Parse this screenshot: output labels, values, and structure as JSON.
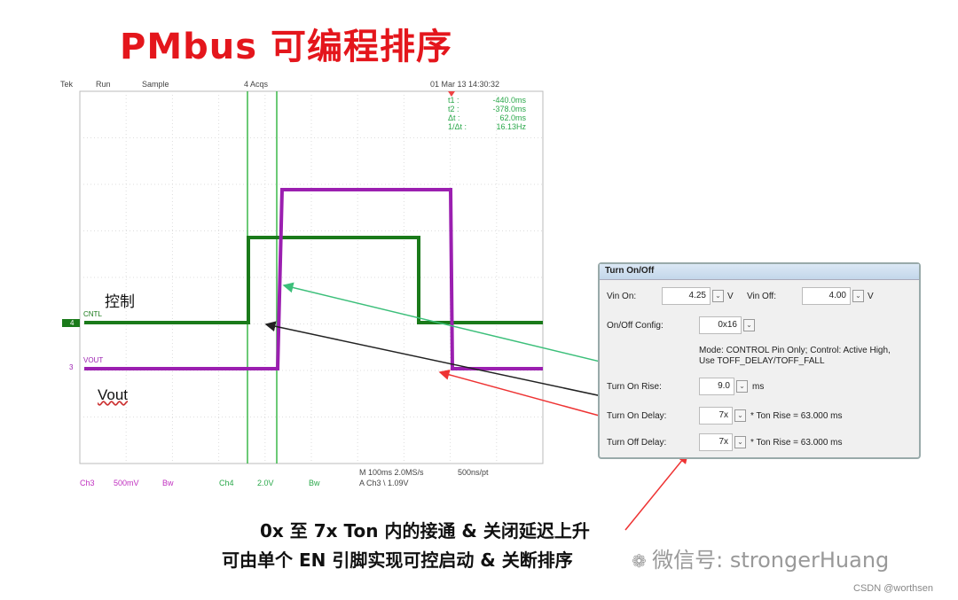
{
  "title": "PMbus 可编程排序",
  "scope": {
    "header": {
      "brand": "Tek",
      "state": "Run",
      "mode": "Sample",
      "acqs": "4 Acqs",
      "datetime": "01 Mar 13 14:30:32"
    },
    "cursors": [
      {
        "k": "t1 :",
        "v": "-440.0ms"
      },
      {
        "k": "t2 :",
        "v": "-378.0ms"
      },
      {
        "k": "Δt :",
        "v": "62.0ms"
      },
      {
        "k": "1/Δt :",
        "v": "16.13Hz"
      }
    ],
    "footer": {
      "ch3": "Ch3",
      "ch3_scale": "500mV",
      "ch3_bw": "Bw",
      "ch4": "Ch4",
      "ch4_scale": "2.0V",
      "ch4_bw": "Bw",
      "timebase": "M 100ms 2.0MS/s",
      "trigger": "A  Ch3  \\  1.09V",
      "pts": "500ns/pt"
    },
    "ch4_label": "CNTL",
    "ch4_marker": "4",
    "ch3_label": "VOUT",
    "ch3_marker": "3",
    "colors": {
      "ch4": "#1a7a1a",
      "ch3": "#9b1fb0",
      "cursor": "#3cb84a"
    }
  },
  "annotations": {
    "control": "控制",
    "vout": "Vout"
  },
  "panel": {
    "title": "Turn On/Off",
    "vin_on_label": "Vin On:",
    "vin_on": "4.25",
    "vin_on_unit": "V",
    "vin_off_label": "Vin Off:",
    "vin_off": "4.00",
    "vin_off_unit": "V",
    "config_label": "On/Off Config:",
    "config": "0x16",
    "mode_text1": "Mode: CONTROL Pin Only; Control: Active High,",
    "mode_text2": "Use TOFF_DELAY/TOFF_FALL",
    "rise_label": "Turn On Rise:",
    "rise": "9.0",
    "rise_unit": "ms",
    "on_delay_label": "Turn On Delay:",
    "on_delay": "7x",
    "on_delay_calc": "* Ton Rise =  63.000 ms",
    "off_delay_label": "Turn Off Delay:",
    "off_delay": "7x",
    "off_delay_calc": "* Ton Rise =  63.000 ms"
  },
  "caption": {
    "line1": "0x 至 7x Ton 内的接通 & 关闭延迟上升",
    "line2": "可由单个 EN 引脚实现可控启动 & 关断排序"
  },
  "watermark": "微信号: strongerHuang",
  "credit": "CSDN @worthsen"
}
